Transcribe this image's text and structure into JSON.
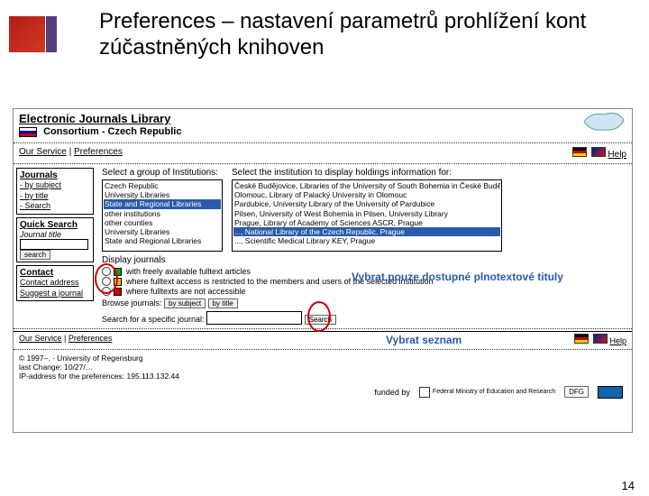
{
  "slide": {
    "title": "Preferences – nastavení parametrů prohlížení kont zúčastněných knihoven",
    "pageNumber": "14"
  },
  "head": {
    "ejl": "Electronic Journals Library",
    "consort": "Consortium - Czech Republic"
  },
  "nav": {
    "ourService": "Our Service",
    "prefs": "Preferences",
    "help": "Help"
  },
  "sidebar": {
    "journals": "Journals",
    "bySubject": "- by subject",
    "byTitle": "- by title",
    "search": "- Search",
    "quick": "Quick Search",
    "jt": "Journal title",
    "btn": "search",
    "contact": "Contact",
    "addr": "Contact address",
    "suggest": "Suggest a journal"
  },
  "content": {
    "selGroup": "Select a group of Institutions:",
    "selInst": "Select the institution to display holdings information for:",
    "g": [
      "Czech Republic",
      "University Libraries",
      "State and Regional Libraries",
      "other institutions",
      "other counties",
      "University Libraries",
      "State and Regional Libraries"
    ],
    "i": [
      "České Budějovice, Libraries of the University of South Bohemia in České Budějovice",
      "Olomouc, Library of Palacký University in Olomouc",
      "Pardubice, University Library of the University of Pardubice",
      "Pilsen, University of West Bohemia in Pilsen, University Library",
      "Prague, Library of Academy of Sciences ASCR, Prague",
      "..., National Library of the Czech Republic, Prague",
      "..., Scientific Medical Library KEY, Prague"
    ],
    "disp": "Display journals",
    "r1": "with freely available fulltext articles",
    "r2": "where fulltext access is restricted to the members and users of the selected institution",
    "r3": "where fulltexts are not accessible",
    "browse": "Browse journals:",
    "bsub": "by subject",
    "btit": "by title",
    "searchSpec": "Search for a specific journal:",
    "sbtn": "Search"
  },
  "bottom": {
    "os": "Our Service",
    "pr": "Preferences",
    "hl": "Help"
  },
  "copy": {
    "c": "© 1997–. · University of Regensburg",
    "lc": "last Change: 10/27/…",
    "ip": "IP-address for the preferences: 195.113.132.44",
    "funded": "funded by",
    "bm": "Federal Ministry of Education and Research",
    "dfg": "DFG"
  },
  "annot": {
    "a1": "Vybrat pouze dostupné plnotextové tituly",
    "a2": "Vybrat seznam"
  }
}
